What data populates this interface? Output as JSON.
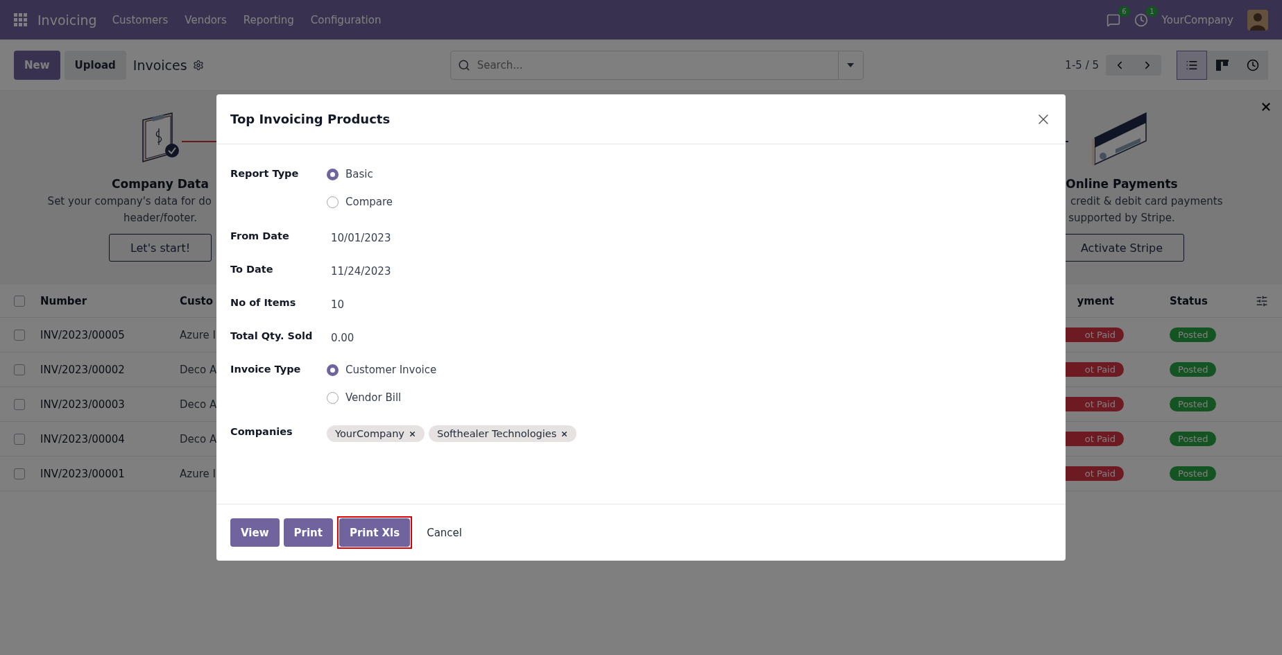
{
  "navbar": {
    "app_name": "Invoicing",
    "menu": [
      "Customers",
      "Vendors",
      "Reporting",
      "Configuration"
    ],
    "messages_count": "6",
    "activities_count": "1",
    "company": "YourCompany"
  },
  "control_panel": {
    "buttons": [
      {
        "label": "New",
        "kind": "primary"
      },
      {
        "label": "Upload",
        "kind": "secondary"
      }
    ],
    "title": "Invoices",
    "search": {
      "placeholder": "Search..."
    },
    "pager": "1-5 / 5",
    "views": [
      {
        "kind": "list",
        "selected": true
      },
      {
        "kind": "kanban",
        "selected": false
      },
      {
        "kind": "activity",
        "selected": false
      }
    ]
  },
  "onboarding": {
    "steps": [
      {
        "kind": "company",
        "title": "Company Data",
        "lines": [
          "Set your company's data for do",
          "header/footer."
        ],
        "button": "Let's start!"
      },
      {
        "kind": "payments",
        "title": "Online Payments",
        "lines": [
          "credit & debit card payments",
          "supported by Stripe."
        ],
        "button": "Activate Stripe"
      }
    ]
  },
  "table": {
    "all_checked": false,
    "columns": [
      "Number",
      "Custo",
      "yment",
      "Status"
    ],
    "rows": [
      {
        "checked": false,
        "number": "INV/2023/00005",
        "customer": "Azure I",
        "payment": "ot Paid",
        "status": "Posted"
      },
      {
        "checked": false,
        "number": "INV/2023/00002",
        "customer": "Deco A",
        "payment": "ot Paid",
        "status": "Posted"
      },
      {
        "checked": false,
        "number": "INV/2023/00003",
        "customer": "Deco A",
        "payment": "ot Paid",
        "status": "Posted"
      },
      {
        "checked": false,
        "number": "INV/2023/00004",
        "customer": "Deco A",
        "payment": "ot Paid",
        "status": "Posted"
      },
      {
        "checked": false,
        "number": "INV/2023/00001",
        "customer": "Azure I",
        "payment": "ot Paid",
        "status": "Posted"
      }
    ]
  },
  "dialog": {
    "title": "Top Invoicing Products",
    "fields": [
      {
        "kind": "radio",
        "label": "Report Type",
        "options": [
          {
            "label": "Basic",
            "selected": true
          },
          {
            "label": "Compare",
            "selected": false
          }
        ]
      },
      {
        "kind": "text",
        "label": "From Date",
        "value": "10/01/2023"
      },
      {
        "kind": "text",
        "label": "To Date",
        "value": "11/24/2023"
      },
      {
        "kind": "text",
        "label": "No of Items",
        "value": "10"
      },
      {
        "kind": "text",
        "label": "Total Qty. Sold",
        "value": "0.00"
      },
      {
        "kind": "radio",
        "label": "Invoice Type",
        "options": [
          {
            "label": "Customer Invoice",
            "selected": true
          },
          {
            "label": "Vendor Bill",
            "selected": false
          }
        ]
      },
      {
        "kind": "tags",
        "label": "Companies",
        "tags": [
          "YourCompany",
          "Softhealer Technologies"
        ]
      }
    ],
    "buttons": [
      {
        "label": "View",
        "kind": "primary",
        "highlighted": false
      },
      {
        "label": "Print",
        "kind": "primary",
        "highlighted": false
      },
      {
        "label": "Print Xls",
        "kind": "primary",
        "highlighted": true
      },
      {
        "label": "Cancel",
        "kind": "secondary",
        "highlighted": false
      }
    ]
  }
}
